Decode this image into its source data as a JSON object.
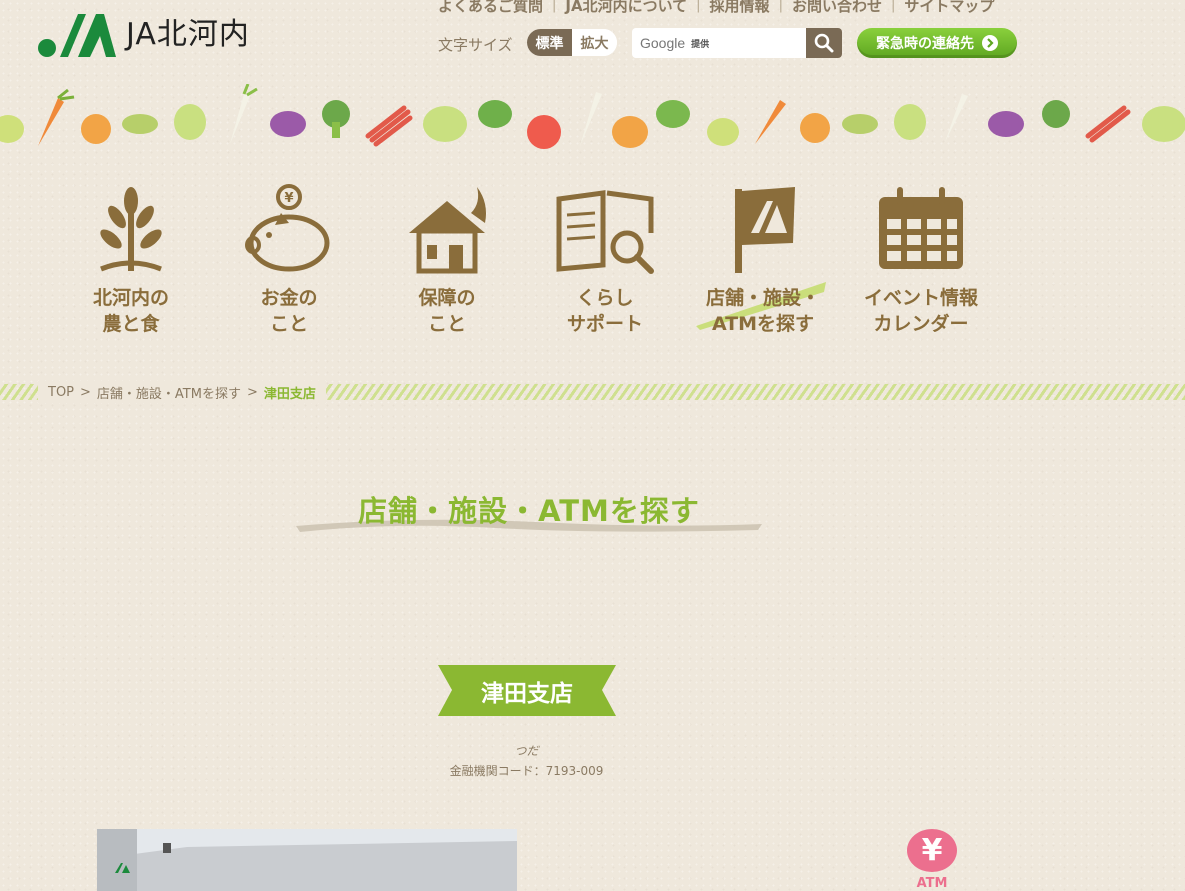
{
  "header": {
    "logo_text": "JA北河内",
    "top_links": [
      "よくあるご質問",
      "JA北河内について",
      "採用情報",
      "お問い合わせ",
      "サイトマップ"
    ],
    "font_size": {
      "label": "文字サイズ",
      "standard": "標準",
      "large": "拡大"
    },
    "search": {
      "google": "Google",
      "provided": "提供",
      "placeholder": ""
    },
    "emergency_label": "緊急時の連絡先"
  },
  "nav": {
    "items": [
      {
        "label": "北河内の\n農と食",
        "icon": "plant-icon"
      },
      {
        "label": "お金の\nこと",
        "icon": "piggy-bank-icon"
      },
      {
        "label": "保障の\nこと",
        "icon": "house-icon"
      },
      {
        "label": "くらし\nサポート",
        "icon": "book-search-icon"
      },
      {
        "label": "店舗・施設・\nATMを探す",
        "icon": "flag-icon"
      },
      {
        "label": "イベント情報\nカレンダー",
        "icon": "calendar-icon"
      }
    ]
  },
  "breadcrumb": {
    "top": "TOP",
    "sep": ">",
    "parent": "店舗・施設・ATMを探す",
    "current": "津田支店"
  },
  "page": {
    "title": "店舗・施設・ATMを探す"
  },
  "branch": {
    "name": "津田支店",
    "kana": "つだ",
    "code": "金融機関コード：7193-009",
    "atm_label": "ATM",
    "atm_symbol": "¥"
  },
  "colors": {
    "accent_green": "#8bb832",
    "brown": "#8a6d3b",
    "atm_pink": "#ec6f8e",
    "logo_green": "#1b8a3c"
  }
}
